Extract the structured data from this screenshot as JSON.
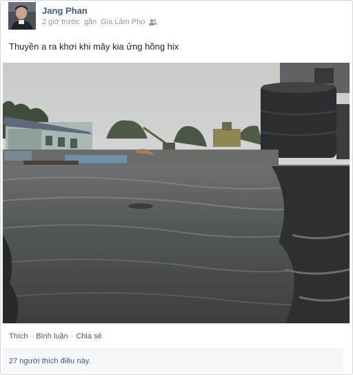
{
  "post": {
    "author": "Jang Phan",
    "time": "2 giờ trước",
    "location_prefix": "gần",
    "location": "Gia Lâm Pho",
    "audience_icon": "friends-icon",
    "message": "Thuyền a ra khơi khi mây kia ửng hồng hix",
    "photo_icon": "flooded-street-photo"
  },
  "actions": {
    "like": "Thích",
    "comment": "Bình luận",
    "share": "Chia sẻ",
    "separator": "·"
  },
  "likes": {
    "summary": "27 người thích điều này."
  },
  "colors": {
    "link": "#3b5998",
    "meta": "#90949c",
    "border": "#d3d6db"
  }
}
